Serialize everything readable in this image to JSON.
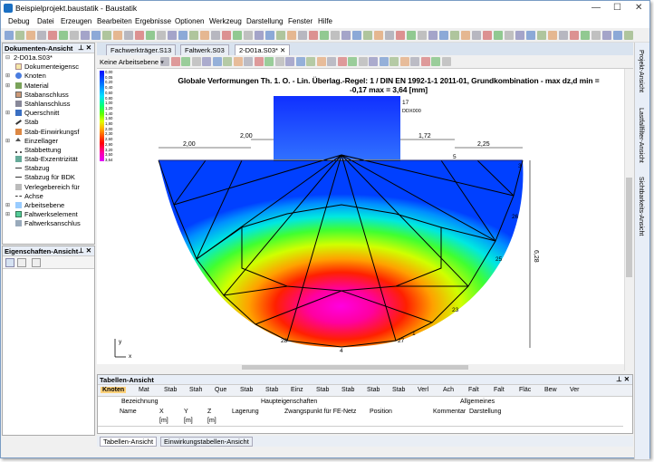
{
  "window": {
    "title": "Beispielprojekt.baustatik - Baustatik"
  },
  "menu": [
    "Debug",
    "Datei",
    "Erzeugen",
    "Bearbeiten",
    "Ergebnisse",
    "Optionen",
    "Werkzeug",
    "Darstellung",
    "Fenster",
    "Hilfe"
  ],
  "docs": {
    "title": "Dokumenten-Ansicht",
    "root": "2-D01a.S03*",
    "items": [
      "Dokumenteigensc",
      "Knoten",
      "Material",
      "Stabanschluss",
      "Stahlanschluss",
      "Querschnitt",
      "Stab",
      "Stab-Einwirkungsf",
      "Einzellager",
      "Stabbettung",
      "Stab-Exzentrizität",
      "Stabzug",
      "Stabzug für BDK",
      "Verlegebereich für",
      "Achse",
      "Arbeitsebene",
      "Faltwerkselement",
      "Faltwerksanschlus"
    ]
  },
  "props": {
    "title": "Eigenschaften-Ansicht"
  },
  "tabs": [
    "Fachwerkträger.S13",
    "Faltwerk.S03",
    "2-D01a.S03*"
  ],
  "toolbar2": {
    "layer": "Keine Arbeitsebene"
  },
  "plot": {
    "title_line1": "Globale Verformungen Th. 1. O. - Lin. Überlag.-Regel: 1 / DIN EN 1992-1-1 2011-01, Grundkombination - max dz,d min =",
    "title_line2": "-0,17 max = 3,64 [mm]",
    "legend": [
      "0,00",
      "0,05",
      "0,20",
      "0,40",
      "0,60",
      "0,80",
      "1,00",
      "1,20",
      "1,40",
      "1,60",
      "1,80",
      "2,00",
      "2,30",
      "2,60",
      "2,90",
      "3,20",
      "3,50",
      "3,64"
    ],
    "dims": {
      "d1": "2,00",
      "d2": "2,00",
      "d3": "1,72",
      "d4": "2,25",
      "d5": "6,28"
    },
    "nodes": {
      "n1": "17",
      "n2": "5",
      "n3": "3",
      "n4": "26",
      "n5": "25",
      "n6": "23",
      "n7": "1",
      "n8": "27",
      "n9": "28",
      "n10": "4",
      "n11": "20",
      "n12": "DDX000"
    },
    "axis": {
      "x": "x",
      "y": "y"
    }
  },
  "tableview": {
    "title": "Tabellen-Ansicht",
    "tabs": [
      "Knoten",
      "Mat",
      "Stab",
      "Stah",
      "Que",
      "Stab",
      "Stab",
      "Einz",
      "Stab",
      "Stab",
      "Stab",
      "Stab",
      "Verl",
      "Ach",
      "Falt",
      "Falt",
      "Fläc",
      "Bew",
      "Ver"
    ],
    "group_bez": "Bezeichnung",
    "group_haupt": "Haupteigenschaften",
    "group_allg": "Allgemeines",
    "cols": [
      "Name",
      "X",
      "Y",
      "Z",
      "Lagerung",
      "Zwangspunkt für FE-Netz",
      "Position",
      "Kommentar",
      "Darstellung"
    ],
    "units": [
      "[m]",
      "[m]",
      "[m]"
    ]
  },
  "bottomtabs": [
    "Tabellen-Ansicht",
    "Einwirkungstabellen-Ansicht"
  ],
  "rightstrip": [
    "Projekt-Ansicht",
    "Lastfallfilter-Ansicht",
    "Sichtbarkeits-Ansicht"
  ]
}
